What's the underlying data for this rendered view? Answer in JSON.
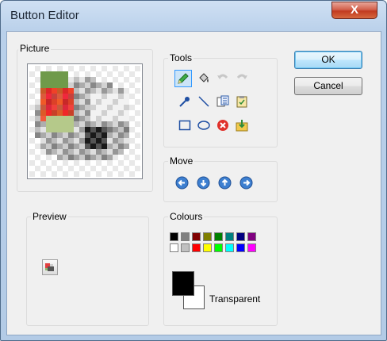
{
  "window": {
    "title": "Button Editor",
    "close_label": "X"
  },
  "groups": {
    "picture": "Picture",
    "tools": "Tools",
    "move": "Move",
    "preview": "Preview",
    "colours": "Colours"
  },
  "buttons": {
    "ok": "OK",
    "cancel": "Cancel"
  },
  "tools": {
    "row1": [
      "pencil-icon",
      "fill-bucket-icon",
      "undo-icon",
      "redo-icon"
    ],
    "row2": [
      "dropper-icon",
      "line-icon",
      "copy-icon",
      "paste-icon"
    ],
    "row3": [
      "rectangle-icon",
      "ellipse-icon",
      "clear-icon",
      "import-icon"
    ],
    "selected": "pencil-icon"
  },
  "move": [
    "move-left-icon",
    "move-down-icon",
    "move-up-icon",
    "move-right-icon"
  ],
  "palette": {
    "row1": [
      "#000000",
      "#808080",
      "#800000",
      "#808000",
      "#008000",
      "#008080",
      "#000080",
      "#800080"
    ],
    "row2": [
      "#ffffff",
      "#c0c0c0",
      "#ff0000",
      "#ffff00",
      "#00ff00",
      "#00ffff",
      "#0000ff",
      "#ff00ff"
    ],
    "foreground": "#000000",
    "background": "#ffffff",
    "transparent_label": "Transparent"
  }
}
